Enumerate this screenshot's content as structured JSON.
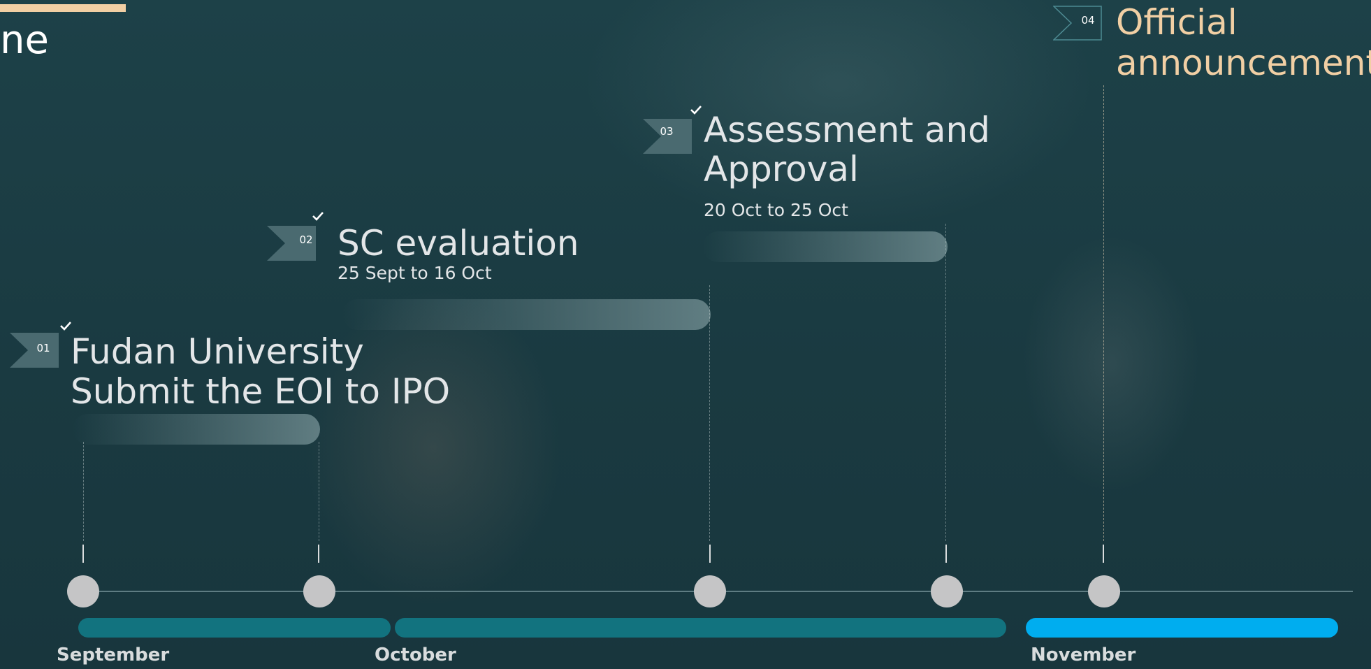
{
  "slide": {
    "title_fragment": "ne"
  },
  "milestones": [
    {
      "number": "01",
      "title_line1": "Fudan University",
      "title_line2": "Submit the EOI to IPO",
      "completed": true
    },
    {
      "number": "02",
      "title_line1": "SC evaluation",
      "date": "25 Sept to 16 Oct",
      "completed": true
    },
    {
      "number": "03",
      "title_line1": "Assessment and",
      "title_line2": "Approval",
      "date": "20 Oct to 25 Oct",
      "completed": true
    },
    {
      "number": "04",
      "title_line1": "Official",
      "title_line2": "announcement",
      "completed": false
    }
  ],
  "timeline": {
    "months": [
      "September",
      "October",
      "November"
    ]
  },
  "colors": {
    "accent": "#f1cfa4",
    "announcement_text": "#f1cfa4",
    "month_bar_past": "#12737f",
    "month_bar_current": "#00adef",
    "dot": "#c5c5c6"
  },
  "icons": {
    "flag": "ribbon-flag-icon",
    "check": "checkmark-icon"
  }
}
